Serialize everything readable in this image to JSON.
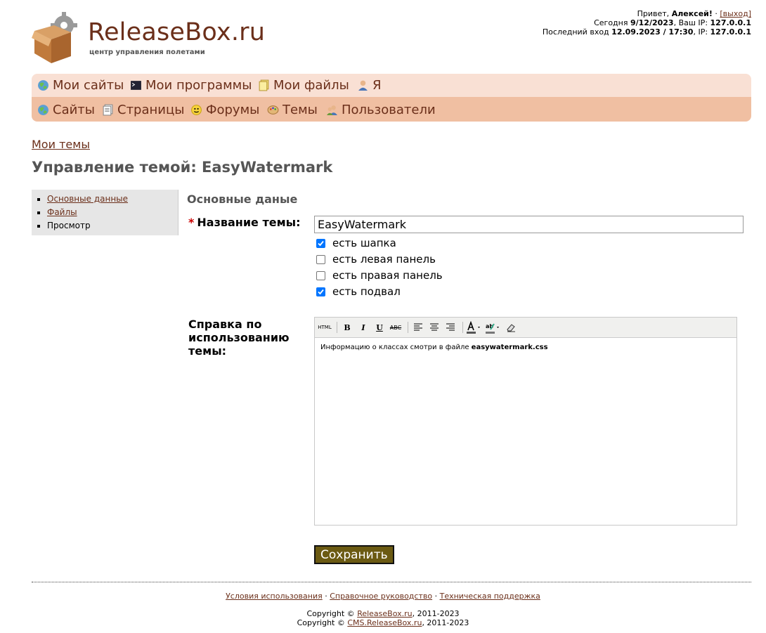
{
  "logo": {
    "title": "ReleaseBox.ru",
    "subtitle": "центр управления полетами"
  },
  "user": {
    "greeting": "Привет,",
    "name": "Алексей!",
    "logout_label": "[выход]",
    "today_label": "Сегодня",
    "today_date": "9/12/2023",
    "ip_label": ", Ваш IP:",
    "ip": "127.0.0.1",
    "last_login_label": "Последний вход",
    "last_login": "12.09.2023 / 17:30",
    "ip_label2": ", IP:",
    "ip2": "127.0.0.1"
  },
  "menu_top": [
    {
      "label": "Мои сайты",
      "icon": "globe-icon"
    },
    {
      "label": "Мои программы",
      "icon": "terminal-icon"
    },
    {
      "label": "Мои файлы",
      "icon": "files-icon"
    },
    {
      "label": "Я",
      "icon": "user-icon"
    }
  ],
  "menu_bottom": [
    {
      "label": "Сайты",
      "icon": "globe-icon"
    },
    {
      "label": "Страницы",
      "icon": "pages-icon"
    },
    {
      "label": "Форумы",
      "icon": "smiley-icon"
    },
    {
      "label": "Темы",
      "icon": "palette-icon"
    },
    {
      "label": "Пользователи",
      "icon": "users-icon"
    }
  ],
  "breadcrumb": "Мои темы",
  "page_title": "Управление темой: EasyWatermark",
  "sidebar": {
    "items": [
      {
        "label": "Основные данные"
      },
      {
        "label": "Файлы"
      },
      {
        "label": "Просмотр"
      }
    ]
  },
  "form": {
    "section_title": "Основные даные",
    "name_label": "Название темы:",
    "name_value": "EasyWatermark",
    "checkboxes": [
      {
        "label": "есть шапка",
        "checked": true
      },
      {
        "label": "есть левая панель",
        "checked": false
      },
      {
        "label": "есть правая панель",
        "checked": false
      },
      {
        "label": "есть подвал",
        "checked": true
      }
    ],
    "help_label": "Справка по использованию темы:",
    "editor_text": "Информацию о классах смотри в файле ",
    "editor_bold": "easywatermark.css",
    "save_label": "Сохранить"
  },
  "editor_toolbar": {
    "html": "HTML",
    "bold": "B",
    "italic": "I",
    "underline": "U",
    "strike": "ABC"
  },
  "footer": {
    "links": [
      "Условия использования",
      "Справочное руководство",
      "Техническая поддержка"
    ],
    "sep": "·",
    "copy_prefix": "Copyright ©",
    "copy1_link": "ReleaseBox.ru",
    "copy2_link": "CMS.ReleaseBox.ru",
    "copy_years": ", 2011-2023"
  },
  "colors": {
    "brand": "#6b2f1a",
    "menu_top": "#f9e0d4",
    "menu_bottom": "#f0bfa2",
    "save_button": "#6b5a12"
  }
}
